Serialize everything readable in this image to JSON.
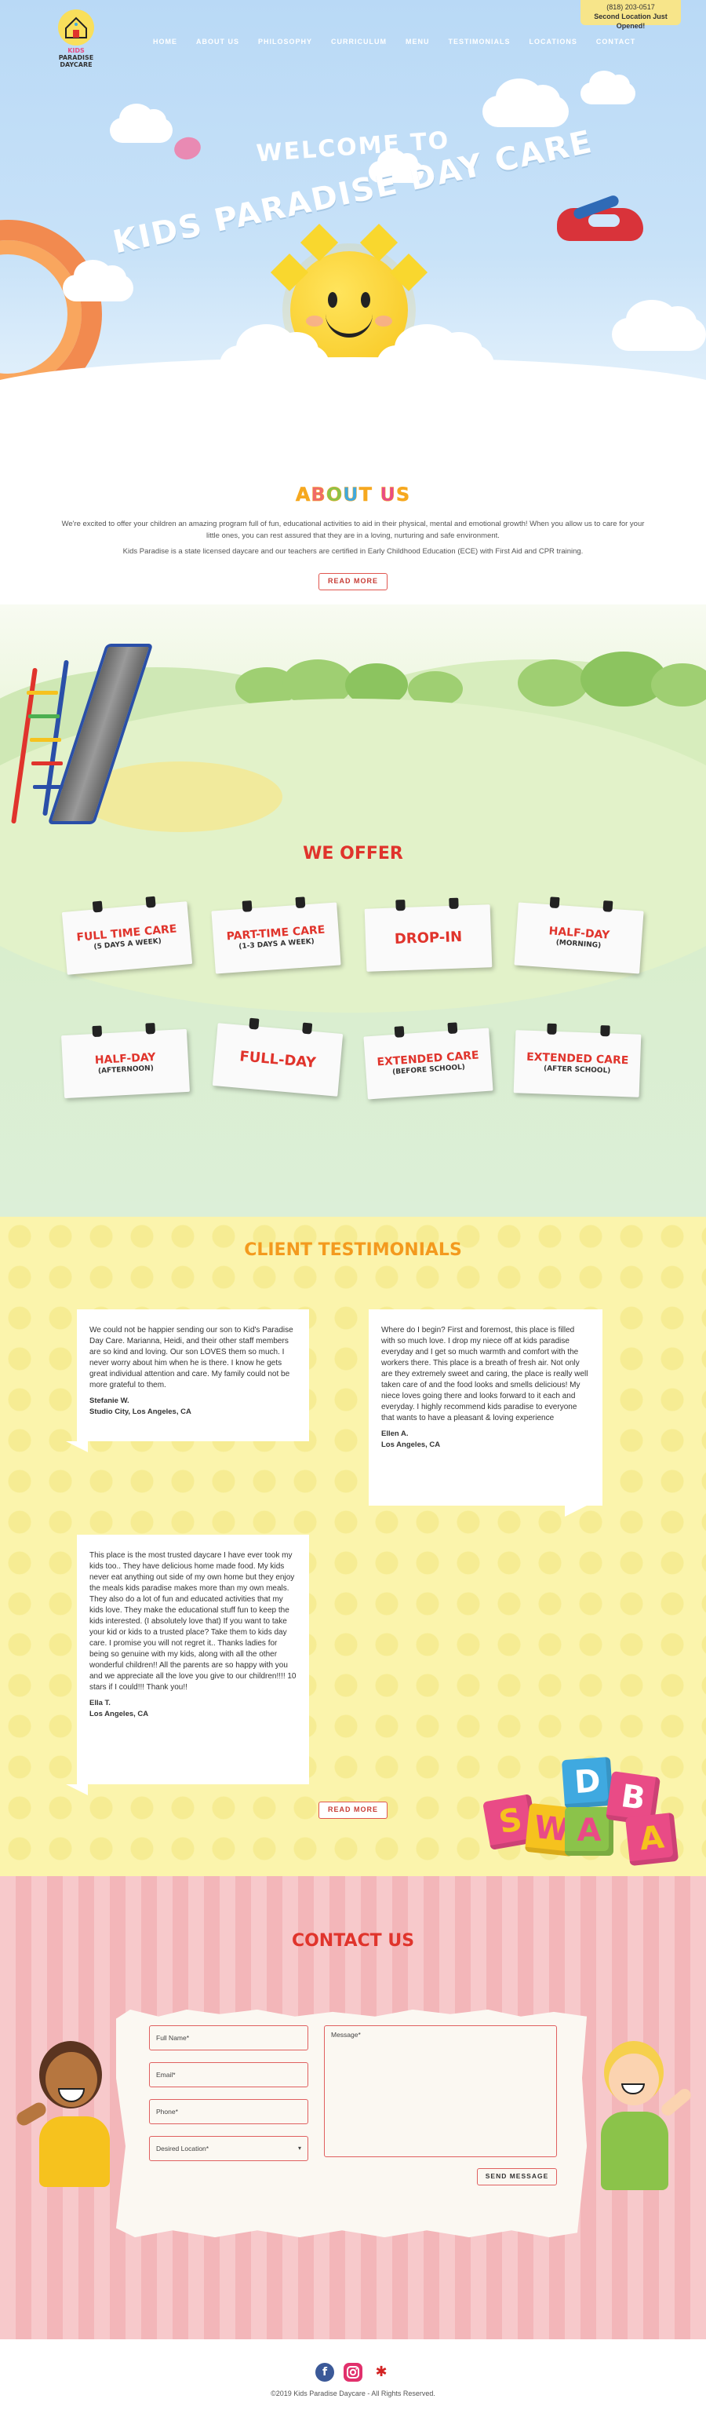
{
  "brand": {
    "name_line1": "KIDS",
    "name_line2": "PARADISE",
    "name_line3": "DAYCARE",
    "colors": {
      "red": "#e0342c",
      "orange": "#f39a1e",
      "sky": "#b9d9f6"
    }
  },
  "nav": {
    "items": [
      "HOME",
      "ABOUT US",
      "PHILOSOPHY",
      "CURRICULUM",
      "MENU",
      "TESTIMONIALS",
      "LOCATIONS",
      "CONTACT"
    ]
  },
  "top_badge": {
    "phone": "(818) 203-0517",
    "note": "Second Location Just Opened!"
  },
  "hero": {
    "welcome_line1": "WELCOME TO",
    "welcome_line2": "KIDS PARADISE DAY CARE"
  },
  "about": {
    "title_letters": [
      "A",
      "B",
      "O",
      "U",
      "T",
      " ",
      "U",
      "S"
    ],
    "paragraph1": "We're excited to offer your children an amazing program full of fun, educational activities to aid in their physical, mental and emotional growth! When you allow us to care for your little ones, you can rest assured that they are in a loving, nurturing and safe environment.",
    "paragraph2": "Kids Paradise is a state licensed daycare and our teachers are certified in Early Childhood Education (ECE) with First Aid and CPR training.",
    "button": "READ MORE"
  },
  "offer": {
    "title": "WE OFFER",
    "cards": [
      {
        "main": "FULL TIME CARE",
        "sub": "(5 DAYS A WEEK)"
      },
      {
        "main": "PART-TIME CARE",
        "sub": "(1-3 DAYS A WEEK)"
      },
      {
        "main": "DROP-IN",
        "sub": ""
      },
      {
        "main": "HALF-DAY",
        "sub": "(MORNING)"
      },
      {
        "main": "HALF-DAY",
        "sub": "(AFTERNOON)"
      },
      {
        "main": "FULL-DAY",
        "sub": ""
      },
      {
        "main": "EXTENDED CARE",
        "sub": "(BEFORE SCHOOL)"
      },
      {
        "main": "EXTENDED CARE",
        "sub": "(AFTER SCHOOL)"
      }
    ]
  },
  "testimonials": {
    "title": "CLIENT TESTIMONIALS",
    "items": [
      {
        "text": "We could not be happier sending our son to Kid's Paradise Day Care. Marianna, Heidi, and their other staff members are so kind and loving. Our son LOVES them so much. I never worry about him when he is there. I know he gets great individual attention and care. My family could not be more grateful to them.",
        "name": "Stefanie W.",
        "location": "Studio City, Los Angeles, CA"
      },
      {
        "text": "Where do I begin? First and foremost, this place is filled with so much love. I drop my niece off at kids paradise everyday and I get so much warmth and comfort with the workers there. This place is a breath of fresh air. Not only are they extremely sweet and caring, the place is really well taken care of and the food looks and smells delicious! My niece loves going there and looks forward to it each and everyday. I highly recommend kids paradise to everyone that wants to have a pleasant & loving experience",
        "name": "Ellen A.",
        "location": "Los Angeles, CA"
      },
      {
        "text": "This place is the most trusted daycare I have ever took my kids too.. They have delicious home made food. My kids never eat anything out side of my own home but they enjoy the meals kids paradise makes more than my own meals. They also do a lot of fun and educated activities that my kids love. They make the educational stuff fun to keep the kids interested. (I absolutely love that) If you want to take your kid or kids to a trusted place? Take them to kids day care. I promise you will not regret it.. Thanks ladies for being so genuine with my kids, along with all the other wonderful children!! All the parents are so happy with you and we appreciate all the love you give to our children!!!! 10 stars if I could!!! Thank you!!",
        "name": "Ella T.",
        "location": "Los Angeles, CA"
      }
    ],
    "button": "READ MORE",
    "blocks": [
      "S",
      "W",
      "D",
      "A",
      "B",
      "A"
    ]
  },
  "contact": {
    "title": "CONTACT US",
    "fields": {
      "full_name": "Full Name*",
      "email": "Email*",
      "phone": "Phone*",
      "location": "Desired Location*",
      "message": "Message*"
    },
    "button": "SEND MESSAGE"
  },
  "footer": {
    "social": [
      "facebook-icon",
      "instagram-icon",
      "yelp-icon"
    ],
    "copyright": "©2019 Kids Paradise Daycare - All Rights Reserved."
  }
}
